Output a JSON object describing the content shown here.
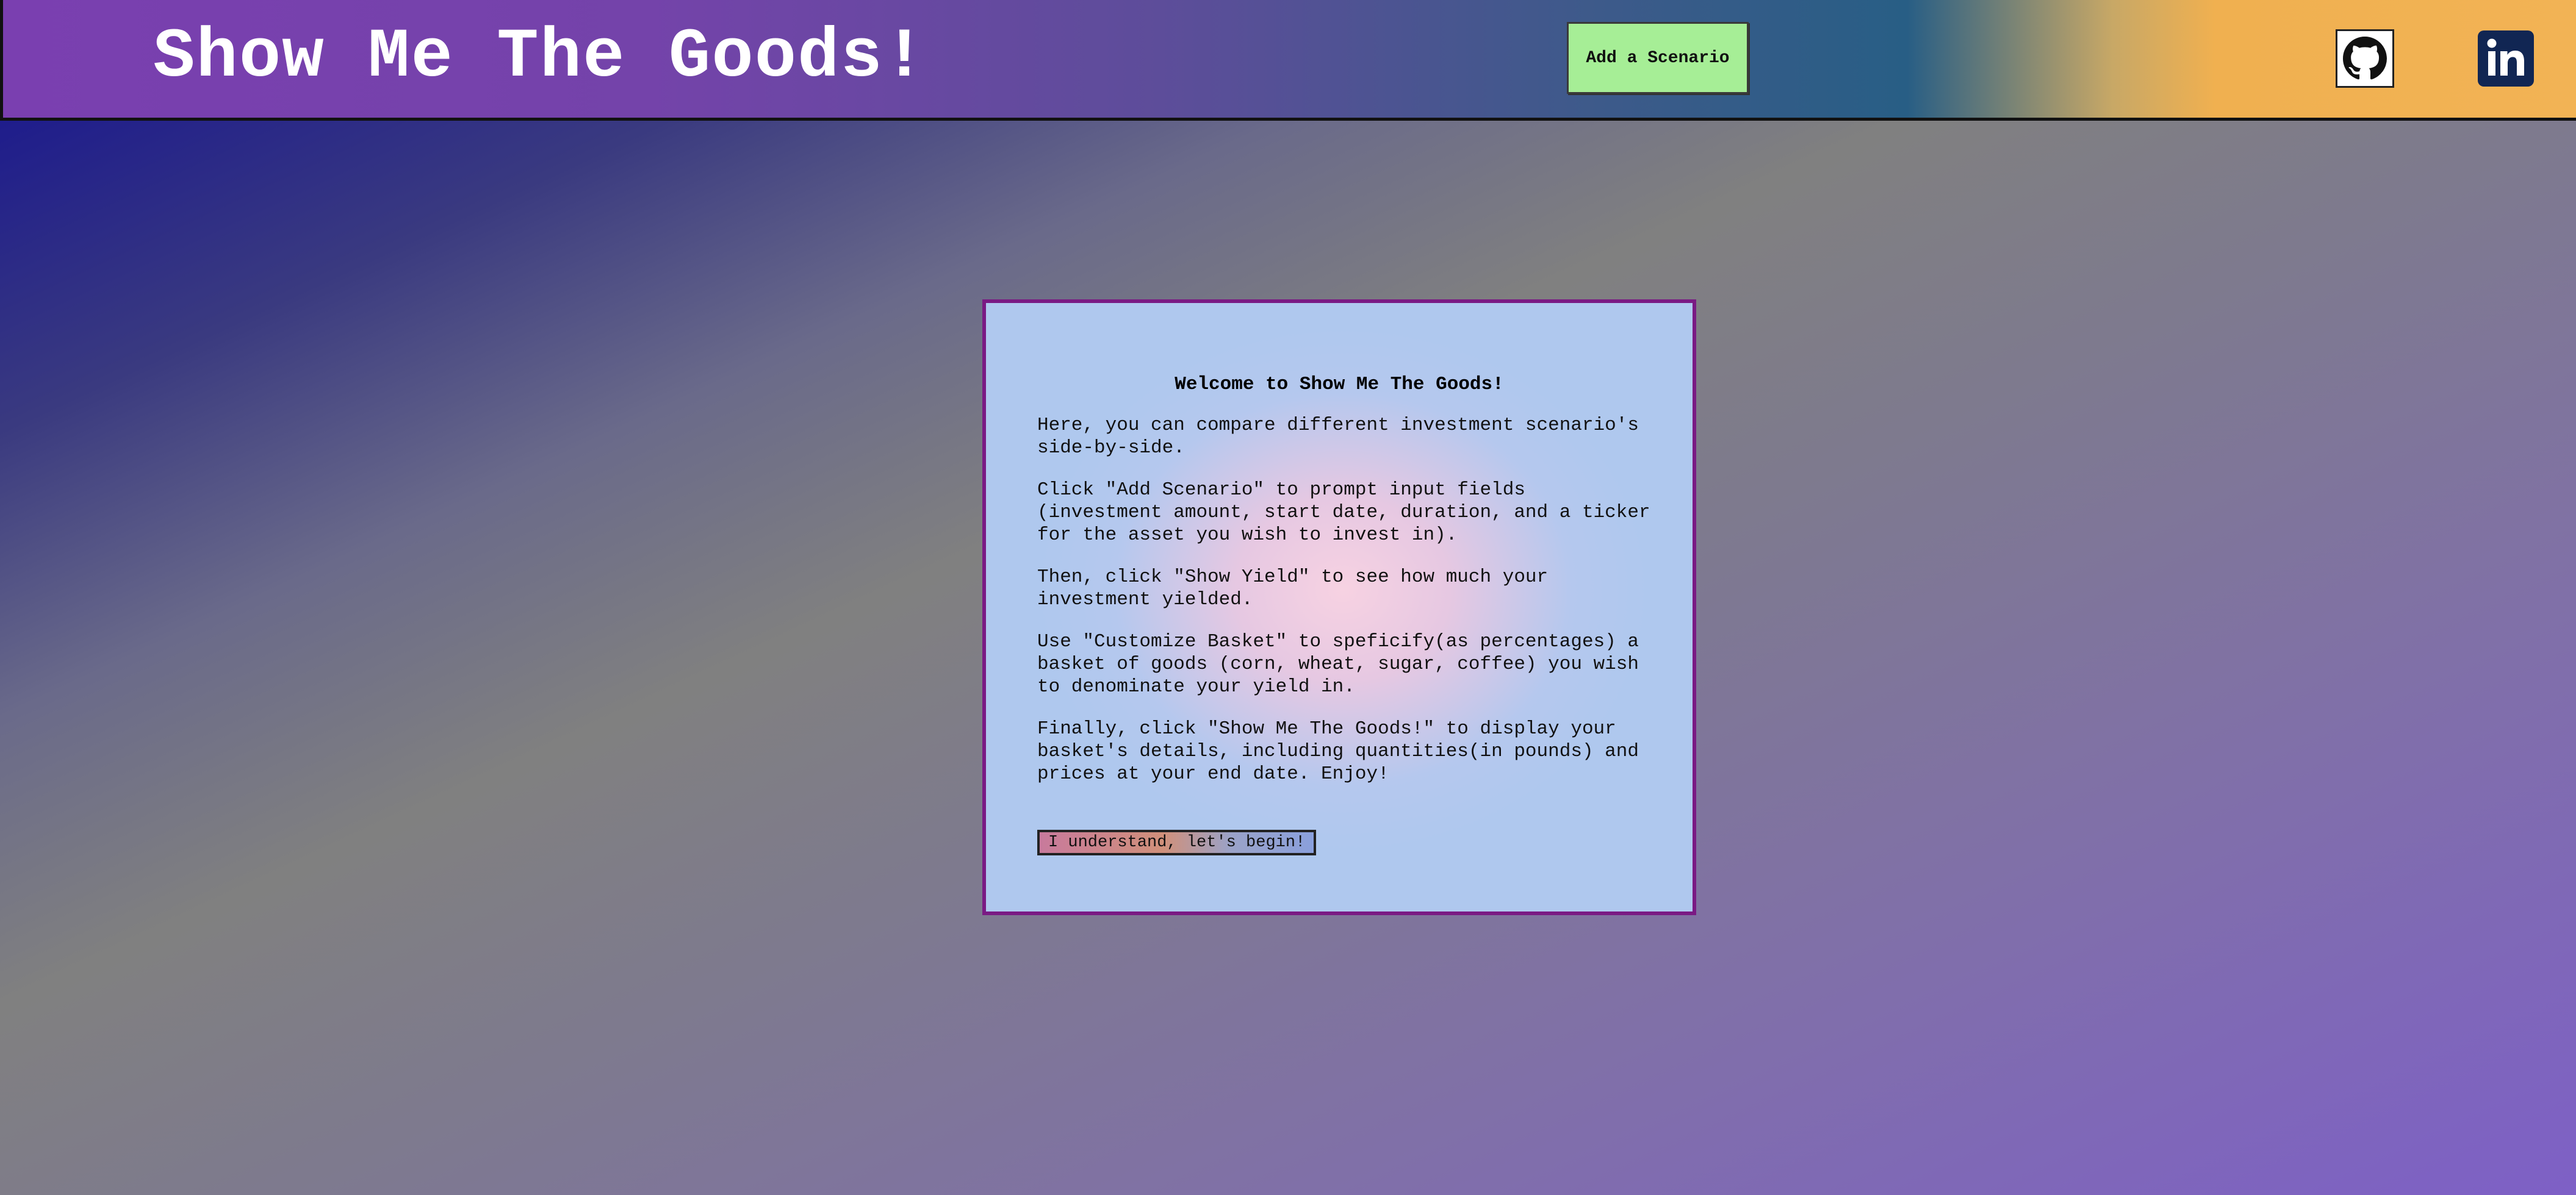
{
  "header": {
    "title": "Show Me The Goods!",
    "add_scenario_label": "Add a Scenario",
    "links": [
      {
        "icon": "github-icon"
      },
      {
        "icon": "linkedin-icon"
      }
    ],
    "colors": {
      "brand_purple": "#7a3fb0",
      "accent_orange": "#f2b355",
      "button_green": "#a6ee96"
    }
  },
  "welcome": {
    "title": "Welcome to Show Me The Goods!",
    "paragraphs": [
      "Here, you can compare different investment scenario's side-by-side.",
      "Click \"Add Scenario\" to prompt input fields (investment amount, start date, duration, and a ticker for the asset you wish to invest in).",
      "Then, click \"Show Yield\" to see how much your investment yielded.",
      "Use \"Customize Basket\" to speficify(as percentages) a basket of goods (corn, wheat, sugar, coffee) you wish to denominate your yield in.",
      "Finally, click \"Show Me The Goods!\" to display your basket's details, including quantities(in pounds) and prices at your end date. Enjoy!"
    ],
    "begin_label": "I understand, let's begin!"
  }
}
